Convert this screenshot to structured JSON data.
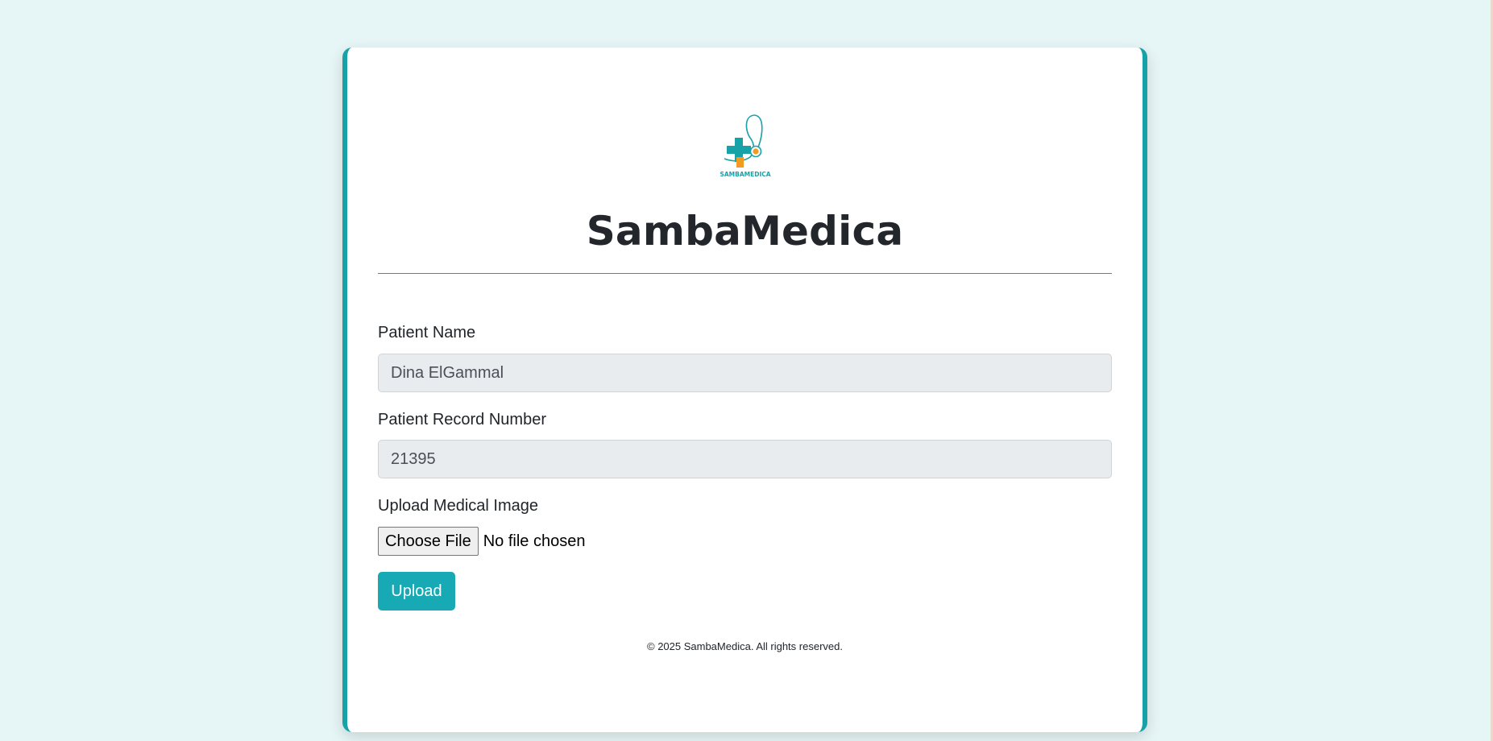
{
  "brand": {
    "logo_text": "SAMBAMEDICA",
    "title": "SambaMedica"
  },
  "form": {
    "patient_name": {
      "label": "Patient Name",
      "value": "Dina ElGammal"
    },
    "record_number": {
      "label": "Patient Record Number",
      "value": "21395"
    },
    "upload_image": {
      "label": "Upload Medical Image",
      "choose_button": "Choose File",
      "status": "No file chosen"
    },
    "submit_label": "Upload"
  },
  "footer": {
    "text": "© 2025 SambaMedica. All rights reserved."
  },
  "colors": {
    "background": "#e6f5f6",
    "accent": "#17a2a8",
    "button": "#17a9b4",
    "logo_orange": "#f29a21"
  }
}
